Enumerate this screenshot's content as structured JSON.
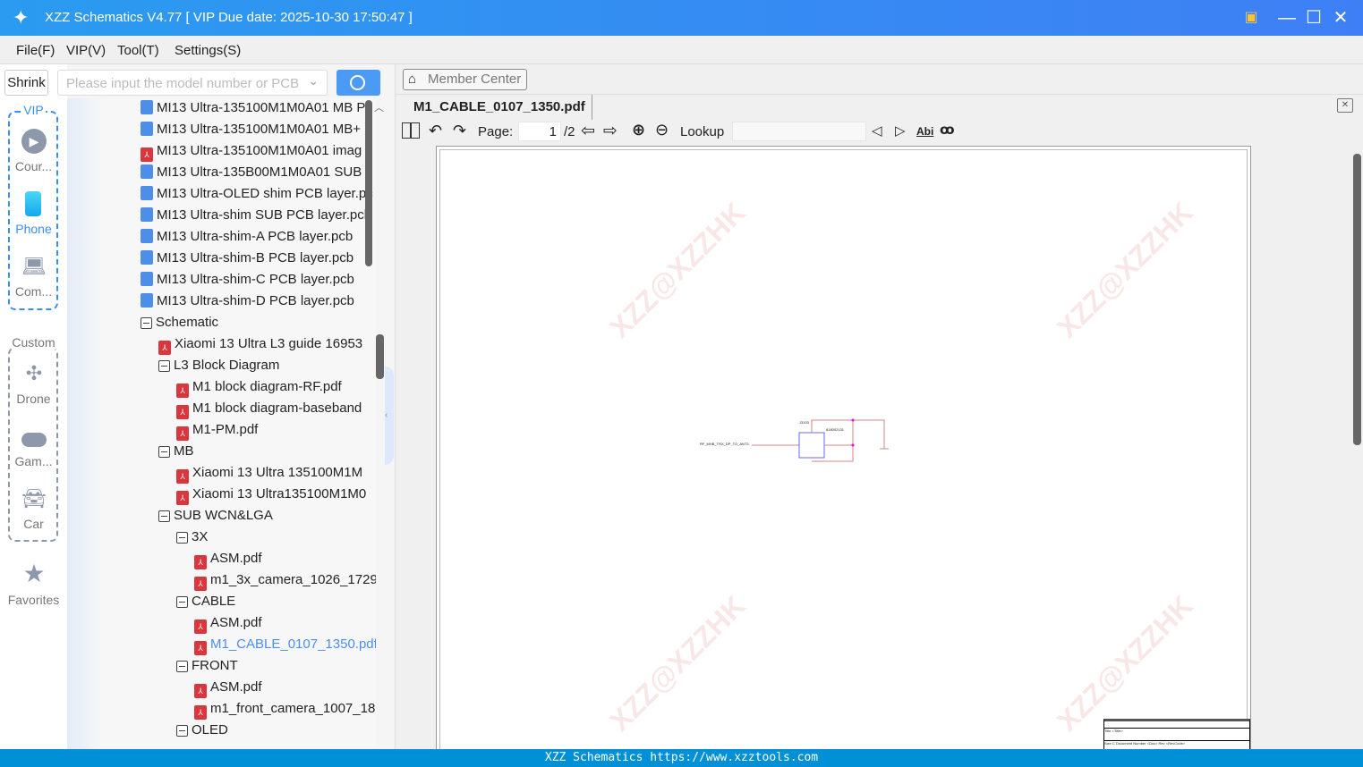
{
  "window": {
    "title": "XZZ Schematics V4.77 [ VIP Due date: 2025-10-30 17:50:47 ]"
  },
  "menu": [
    "File(F)",
    "VIP(V)",
    "Tool(T)",
    "Settings(S)"
  ],
  "search": {
    "shrink_label": "Shrink",
    "placeholder": "Please input the model number or PCB"
  },
  "nav": {
    "vip_label": "VIP",
    "custom_label": "Custom",
    "items": [
      "Cour...",
      "Phone",
      "Com...",
      "Drone",
      "Gam...",
      "Car",
      "Favorites"
    ]
  },
  "tree": [
    {
      "label": "MI13 Ultra-135100M1M0A01 MB P",
      "type": "pcb",
      "level": 0
    },
    {
      "label": "MI13 Ultra-135100M1M0A01 MB+",
      "type": "pcb",
      "level": 0
    },
    {
      "label": "MI13 Ultra-135100M1M0A01 imag",
      "type": "pdf",
      "level": 0
    },
    {
      "label": "MI13 Ultra-135B00M1M0A01 SUB",
      "type": "pcb",
      "level": 0
    },
    {
      "label": "MI13 Ultra-OLED shim PCB layer.pc",
      "type": "pcb",
      "level": 0
    },
    {
      "label": "MI13 Ultra-shim SUB PCB layer.pcb",
      "type": "pcb",
      "level": 0
    },
    {
      "label": "MI13 Ultra-shim-A PCB layer.pcb",
      "type": "pcb",
      "level": 0
    },
    {
      "label": "MI13 Ultra-shim-B PCB layer.pcb",
      "type": "pcb",
      "level": 0
    },
    {
      "label": "MI13 Ultra-shim-C PCB layer.pcb",
      "type": "pcb",
      "level": 0
    },
    {
      "label": "MI13 Ultra-shim-D PCB layer.pcb",
      "type": "pcb",
      "level": 0
    },
    {
      "label": "Schematic",
      "type": "folder",
      "level": 0
    },
    {
      "label": "Xiaomi 13 Ultra L3 guide 16953",
      "type": "pdf",
      "level": 1
    },
    {
      "label": "L3 Block Diagram",
      "type": "folder",
      "level": 1
    },
    {
      "label": "M1 block diagram-RF.pdf",
      "type": "pdf",
      "level": 2
    },
    {
      "label": "M1 block diagram-baseband",
      "type": "pdf",
      "level": 2
    },
    {
      "label": "M1-PM.pdf",
      "type": "pdf",
      "level": 2
    },
    {
      "label": "MB",
      "type": "folder",
      "level": 1
    },
    {
      "label": "Xiaomi 13 Ultra 135100M1M",
      "type": "pdf",
      "level": 2
    },
    {
      "label": "Xiaomi 13 Ultra135100M1M0",
      "type": "pdf",
      "level": 2
    },
    {
      "label": "SUB WCN&LGA",
      "type": "folder",
      "level": 1
    },
    {
      "label": "3X",
      "type": "folder",
      "level": 2
    },
    {
      "label": "ASM.pdf",
      "type": "pdf",
      "level": 3
    },
    {
      "label": "m1_3x_camera_1026_1729",
      "type": "pdf",
      "level": 3
    },
    {
      "label": "CABLE",
      "type": "folder",
      "level": 2
    },
    {
      "label": "ASM.pdf",
      "type": "pdf",
      "level": 3
    },
    {
      "label": "M1_CABLE_0107_1350.pdf",
      "type": "pdf",
      "level": 3,
      "selected": true
    },
    {
      "label": "FRONT",
      "type": "folder",
      "level": 2
    },
    {
      "label": "ASM.pdf",
      "type": "pdf",
      "level": 3
    },
    {
      "label": "m1_front_camera_1007_18",
      "type": "pdf",
      "level": 3
    },
    {
      "label": "OLED",
      "type": "folder",
      "level": 2
    }
  ],
  "viewer": {
    "member_center": "Member Center",
    "tab": "M1_CABLE_0107_1350.pdf",
    "page_label": "Page:",
    "page": "1",
    "page_total": "/2",
    "lookup_label": "Lookup",
    "lookup_value": "",
    "abi": "Abi"
  },
  "schematic": {
    "net": "RF_MHB_TRX_DP_TO_ANT3",
    "ref": "J3103",
    "part": "818002131",
    "title_block": {
      "title": "<Title>",
      "size_label": "Size",
      "size": "C",
      "doc_label": "Document Number",
      "doc": "<Doc>",
      "rev_label": "Rev",
      "rev": "<RevCode>",
      "title_label": "Title"
    }
  },
  "watermark": "XZZ@XZZHK",
  "status": "XZZ Schematics https://www.xzztools.com",
  "colors": {
    "accent": "#3b8ff0",
    "status": "#0090d8",
    "pdf": "#d9363e",
    "pcb": "#4c8ee8"
  }
}
